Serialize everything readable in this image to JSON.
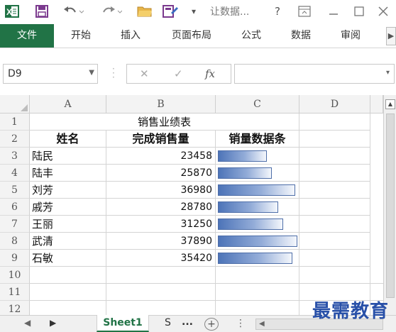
{
  "qat": {
    "title": "让数据...",
    "help": "?"
  },
  "ribbon": {
    "tabs": [
      "文件",
      "开始",
      "插入",
      "页面布局",
      "公式",
      "数据",
      "审阅"
    ]
  },
  "formula_bar": {
    "name_box": "D9",
    "cancel_symbol": "✕",
    "enter_symbol": "✓",
    "fx_symbol": "fx",
    "formula": ""
  },
  "grid": {
    "columns": [
      "A",
      "B",
      "C",
      "D"
    ],
    "rows": [
      "1",
      "2",
      "3",
      "4",
      "5",
      "6",
      "7",
      "8",
      "9",
      "10",
      "11",
      "12"
    ],
    "title": "销售业绩表",
    "headers": [
      "姓名",
      "完成销售量",
      "销量数据条"
    ],
    "data": [
      {
        "name": "陆民",
        "sales": "23458",
        "bar": 23458
      },
      {
        "name": "陆丰",
        "sales": "25870",
        "bar": 25870
      },
      {
        "name": "刘芳",
        "sales": "36980",
        "bar": 36980
      },
      {
        "name": "戚芳",
        "sales": "28780",
        "bar": 28780
      },
      {
        "name": "王丽",
        "sales": "31250",
        "bar": 31250
      },
      {
        "name": "武清",
        "sales": "37890",
        "bar": 37890
      },
      {
        "name": "石敏",
        "sales": "35420",
        "bar": 35420
      }
    ],
    "bar_max": 37890,
    "bar_min": 0
  },
  "sheets": {
    "active": "Sheet1",
    "second": "S",
    "ellipsis": "..."
  },
  "watermark": "最需教育",
  "colors": {
    "excel_green": "#217346",
    "bar_dark": "#4d74b8",
    "bar_light": "#f4f7fc"
  }
}
